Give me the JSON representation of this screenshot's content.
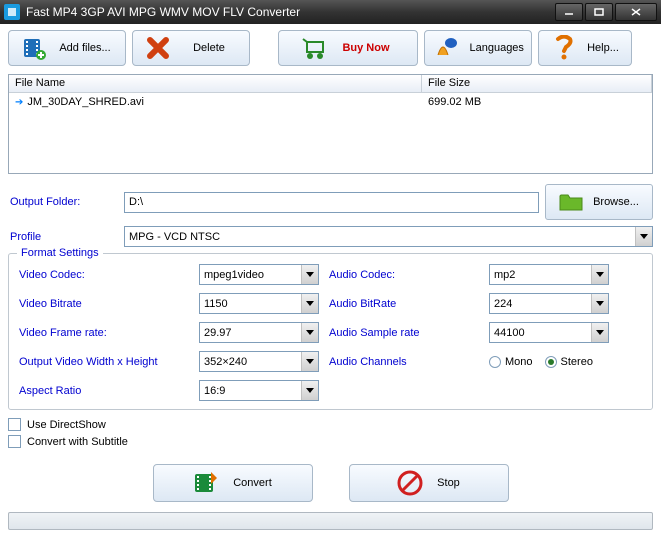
{
  "window": {
    "title": "Fast MP4 3GP AVI MPG WMV MOV FLV Converter"
  },
  "toolbar": {
    "add": "Add files...",
    "delete": "Delete",
    "buy": "Buy Now",
    "lang": "Languages",
    "help": "Help..."
  },
  "filelist": {
    "col_name": "File Name",
    "col_size": "File Size",
    "rows": [
      {
        "name": "JM_30DAY_SHRED.avi",
        "size": "699.02 MB"
      }
    ]
  },
  "output": {
    "folder_label": "Output Folder:",
    "folder_value": "D:\\",
    "browse": "Browse...",
    "profile_label": "Profile",
    "profile_value": "MPG - VCD NTSC"
  },
  "format": {
    "legend": "Format Settings",
    "vcodec_label": "Video Codec:",
    "vcodec": "mpeg1video",
    "vbitrate_label": "Video Bitrate",
    "vbitrate": "1150",
    "vframe_label": "Video Frame rate:",
    "vframe": "29.97",
    "vsize_label": "Output Video Width x Height",
    "vsize": "352×240",
    "aspect_label": "Aspect Ratio",
    "aspect": "16:9",
    "acodec_label": "Audio Codec:",
    "acodec": "mp2",
    "abitrate_label": "Audio BitRate",
    "abitrate": "224",
    "asample_label": "Audio Sample rate",
    "asample": "44100",
    "ach_label": "Audio Channels",
    "mono": "Mono",
    "stereo": "Stereo"
  },
  "options": {
    "directshow": "Use DirectShow",
    "subtitle": "Convert with Subtitle"
  },
  "actions": {
    "convert": "Convert",
    "stop": "Stop"
  }
}
